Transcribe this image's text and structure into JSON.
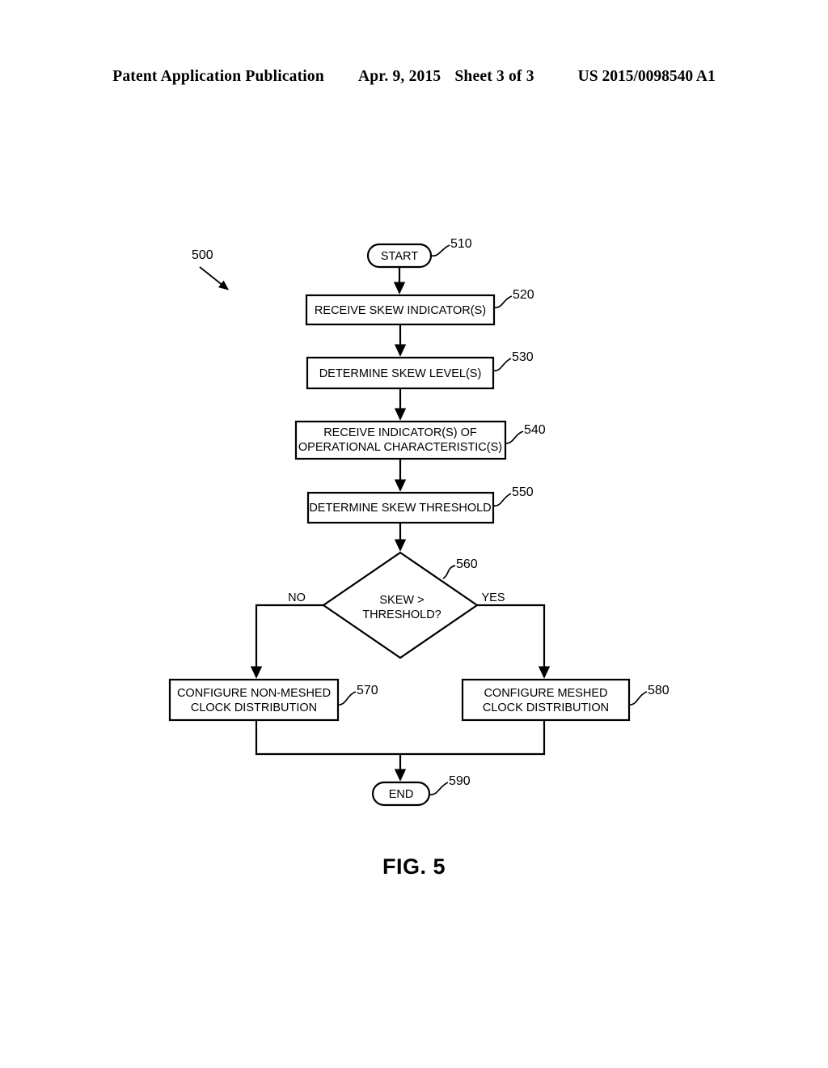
{
  "header": {
    "publication": "Patent Application Publication",
    "date": "Apr. 9, 2015",
    "sheet": "Sheet 3 of 3",
    "number": "US 2015/0098540 A1"
  },
  "figure": {
    "caption": "FIG. 5",
    "diagram_ref": "500",
    "type": "flowchart"
  },
  "flowchart": {
    "nodes": [
      {
        "id": "start",
        "ref": "510",
        "shape": "terminator",
        "lines": [
          "START"
        ]
      },
      {
        "id": "step520",
        "ref": "520",
        "shape": "process",
        "lines": [
          "RECEIVE SKEW INDICATOR(S)"
        ]
      },
      {
        "id": "step530",
        "ref": "530",
        "shape": "process",
        "lines": [
          "DETERMINE SKEW LEVEL(S)"
        ]
      },
      {
        "id": "step540",
        "ref": "540",
        "shape": "process",
        "lines": [
          "RECEIVE INDICATOR(S) OF",
          "OPERATIONAL CHARACTERISTIC(S)"
        ]
      },
      {
        "id": "step550",
        "ref": "550",
        "shape": "process",
        "lines": [
          "DETERMINE SKEW THRESHOLD"
        ]
      },
      {
        "id": "decision",
        "ref": "560",
        "shape": "decision",
        "lines": [
          "SKEW >",
          "THRESHOLD?"
        ]
      },
      {
        "id": "step570",
        "ref": "570",
        "shape": "process",
        "lines": [
          "CONFIGURE NON-MESHED",
          "CLOCK DISTRIBUTION"
        ]
      },
      {
        "id": "step580",
        "ref": "580",
        "shape": "process",
        "lines": [
          "CONFIGURE MESHED",
          "CLOCK DISTRIBUTION"
        ]
      },
      {
        "id": "end",
        "ref": "590",
        "shape": "terminator",
        "lines": [
          "END"
        ]
      }
    ],
    "branches": {
      "no_label": "NO",
      "yes_label": "YES"
    }
  }
}
